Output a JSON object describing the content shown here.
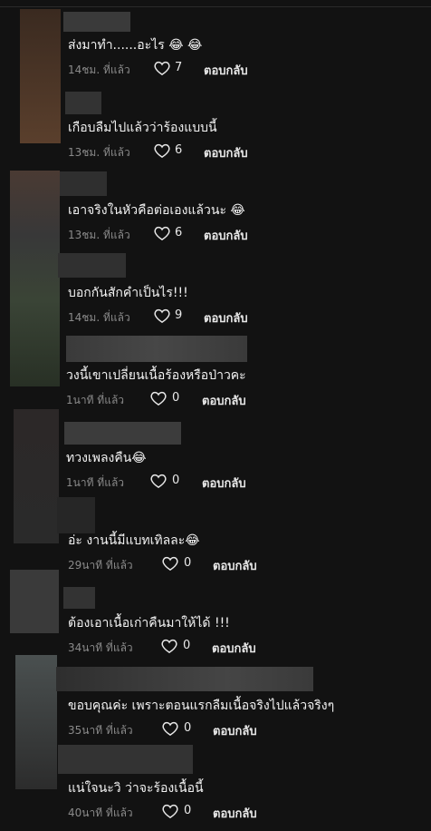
{
  "comments": [
    {
      "text": "ส่งมาทำ......อะไร 😂 😂",
      "time": "14ชม. ที่แล้ว",
      "likes": "7",
      "reply": "ตอบกลับ"
    },
    {
      "text": "เกือบลืมไปแล้วว่าร้องแบบนี้",
      "time": "13ชม. ที่แล้ว",
      "likes": "6",
      "reply": "ตอบกลับ"
    },
    {
      "text": "เอาจริงในหัวคือต่อเองแล้วนะ 😂",
      "time": "13ชม. ที่แล้ว",
      "likes": "6",
      "reply": "ตอบกลับ"
    },
    {
      "text": "บอกกันสักคำเป็นไร!!!",
      "time": "14ชม. ที่แล้ว",
      "likes": "9",
      "reply": "ตอบกลับ"
    },
    {
      "text": "วงนี้เขาเปลี่ยนเนื้อร้องหรือป่าวคะ",
      "time": "1นาที ที่แล้ว",
      "likes": "0",
      "reply": "ตอบกลับ"
    },
    {
      "text": "ทวงเพลงคืน😂",
      "time": "1นาที ที่แล้ว",
      "likes": "0",
      "reply": "ตอบกลับ"
    },
    {
      "text": "อ่ะ งานนี้มีแบทเทิลละ😂",
      "time": "29นาที ที่แล้ว",
      "likes": "0",
      "reply": "ตอบกลับ"
    },
    {
      "text": "ต้องเอาเนื้อเก่าคืนมาให้ได้ !!!",
      "time": "34นาที ที่แล้ว",
      "likes": "0",
      "reply": "ตอบกลับ"
    },
    {
      "text": "ขอบคุณค่ะ เพราะตอนแรกลืมเนื้อจริงไปแล้วจริงๆ",
      "time": "35นาที ที่แล้ว",
      "likes": "0",
      "reply": "ตอบกลับ"
    },
    {
      "text": "แน่ใจนะวิ ว่าจะร้องเนื้อนี้",
      "time": "40นาที ที่แล้ว",
      "likes": "0",
      "reply": "ตอบกลับ"
    }
  ],
  "colors": {
    "background": "#121212",
    "text": "#f2f2f2",
    "meta": "#8a8a8a"
  },
  "icons": {
    "like": "heart-outline-icon"
  }
}
